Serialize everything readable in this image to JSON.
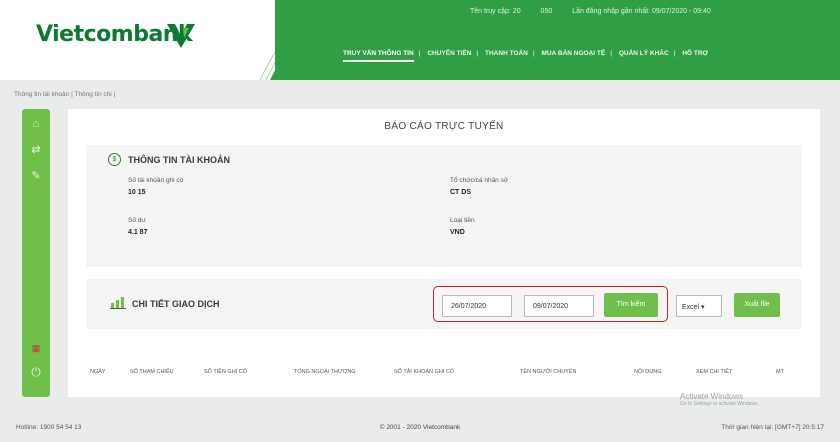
{
  "header": {
    "brand": "Vietcombank",
    "user_label": "Tên truy cập: 20",
    "user_code": "050",
    "last_login": "Lần đăng nhập gần nhất: 09/07/2020 - 09:40",
    "menu": [
      "TRUY VẤN THÔNG TIN",
      "CHUYỂN TIỀN",
      "THANH TOÁN",
      "MUA BÁN NGOẠI TỆ",
      "QUẢN LÝ KHÁC",
      "HỖ TRỢ"
    ]
  },
  "breadcrumb": "Thông tin tài khoản | Thông tin chi |",
  "page_title": "BÁO CÁO TRỰC TUYẾN",
  "account": {
    "section_title": "THÔNG TIN TÀI KHOẢN",
    "acct_no_label": "Số tài khoản ghi có",
    "acct_no_value": "10          15",
    "name_label": "Tổ chức/cá nhân sở",
    "name_value": "CT                DS",
    "balance_label": "Số dư",
    "balance_value": "4.1        87",
    "currency_label": "Loại tiền",
    "currency_value": "VND"
  },
  "detail": {
    "section_title": "CHI TIẾT GIAO DỊCH",
    "from_date": "26/07/2020",
    "to_date": "09/07/2020",
    "search_label": "Tìm kiếm",
    "format_select": "Excel ▾",
    "export_label": "Xuất file"
  },
  "table_headers": [
    "NGÀY",
    "SỐ THAM CHIẾU",
    "SỐ TIỀN GHI CÓ",
    "TỔNG NGOẠI THƯƠNG",
    "SỐ TÀI KHOẢN GHI CÓ",
    "TÊN NGƯỜI CHUYỂN",
    "NỘI DUNG",
    "XEM CHI TIẾT",
    "MT"
  ],
  "footer": {
    "hotline": "Hotline: 1900 54 54 13",
    "copyright": "© 2001 - 2020 Vietcombank",
    "session": "Thời gian hiện tại: [GMT+7] 20:5:17"
  },
  "watermark": {
    "title": "Activate Windows",
    "sub": "Go to Settings to activate Windows."
  },
  "colors": {
    "brand_green": "#0b7a32",
    "accent_green": "#6fbf4a",
    "highlight_red": "#d92121"
  }
}
